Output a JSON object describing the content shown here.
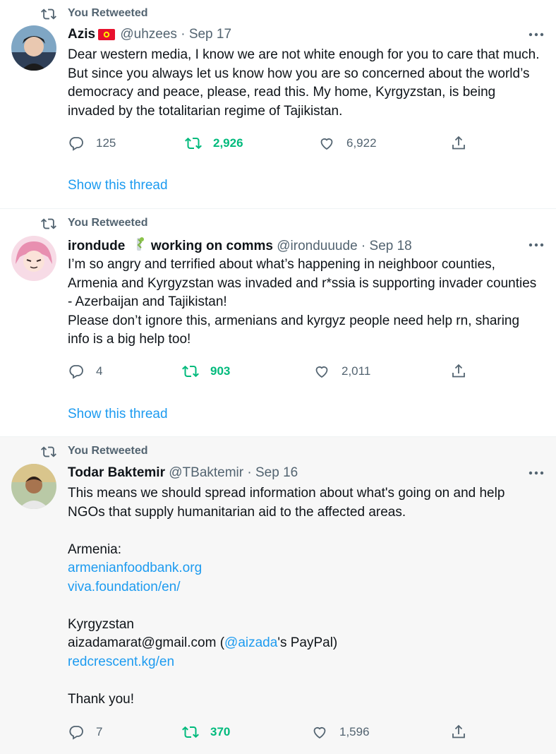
{
  "tweets": [
    {
      "retweet_label": "You Retweeted",
      "name": "Azis",
      "flag_icon": "kyrgyzstan-flag-icon",
      "handle": "@uhzees",
      "dot": "·",
      "date": "Sep 17",
      "text": "Dear western media, I know we are not white enough for you to care that much. But since you always let us know how you are so concerned about the world’s democracy and peace, please, read this. My home, Kyrgyzstan, is being invaded by the totalitarian regime of Tajikistan.",
      "replies": "125",
      "retweets": "2,926",
      "likes": "6,922",
      "show_thread": "Show this thread"
    },
    {
      "retweet_label": "You Retweeted",
      "name": "irondude",
      "name_suffix": "working on comms",
      "handle": "@ironduuude",
      "dot": "·",
      "date": "Sep 18",
      "text": "I’m so angry and terrified about what’s happening in neighboor counties, Armenia and Kyrgyzstan was invaded and r*ssia is supporting invader counties - Azerbaijan and Tajikistan!\nPlease don’t ignore this, armenians and kyrgyz people need help rn, sharing info is a big help too!",
      "replies": "4",
      "retweets": "903",
      "likes": "2,011",
      "show_thread": "Show this thread"
    },
    {
      "retweet_label": "You Retweeted",
      "name": "Todar Baktemir",
      "handle": "@TBaktemir",
      "dot": "·",
      "date": "Sep 16",
      "text": "This means we should spread information about what's going on and help NGOs that supply humanitarian aid to the affected areas.",
      "armenia_label": "Armenia:",
      "link1": "armenianfoodbank.org",
      "link2": "viva.foundation/en/",
      "kyrgyzstan_label": "Kyrgyzstan",
      "email": "aizadamarat@gmail.com (",
      "mention": "@aizada",
      "paypal": "'s PayPal)",
      "link3": "redcrescent.kg/en",
      "thanks": "Thank you!",
      "replies": "7",
      "retweets": "370",
      "likes": "1,596"
    }
  ],
  "colors": {
    "text": "#0f1419",
    "secondary": "#536471",
    "link": "#1d9bf0",
    "retweet_green": "#00ba7c"
  }
}
